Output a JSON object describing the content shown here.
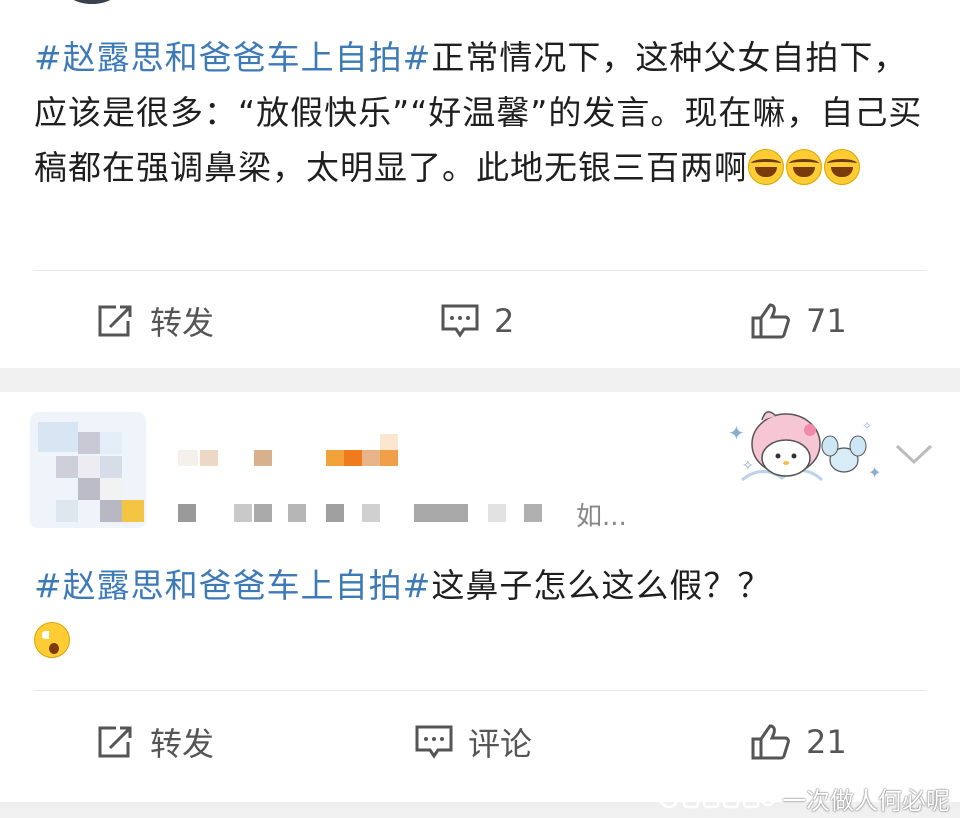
{
  "posts": [
    {
      "hashtag": "#赵露思和爸爸车上自拍#",
      "text": "正常情况下，这种父女自拍下，应该是很多：“放假快乐”“好温馨”的发言。现在嘛，自己买稿都在强调鼻梁，太明显了。此地无银三百两啊",
      "emojis": [
        "crying-laughing",
        "crying-laughing",
        "crying-laughing"
      ],
      "repost_label": "转发",
      "comment_label": "2",
      "like_count": "71"
    },
    {
      "user_meta_text": "如...",
      "hashtag": "#赵露思和爸爸车上自拍#",
      "text": "这鼻子怎么这么假？？",
      "emojis": [
        "shocked"
      ],
      "repost_label": "转发",
      "comment_label": "评论",
      "like_count": "21"
    }
  ],
  "watermark": "一次做人何必呢",
  "colors": {
    "hashtag": "#3d7ab8",
    "text": "#1f1f1f",
    "action": "#555555",
    "separator": "#f0f0f0"
  }
}
